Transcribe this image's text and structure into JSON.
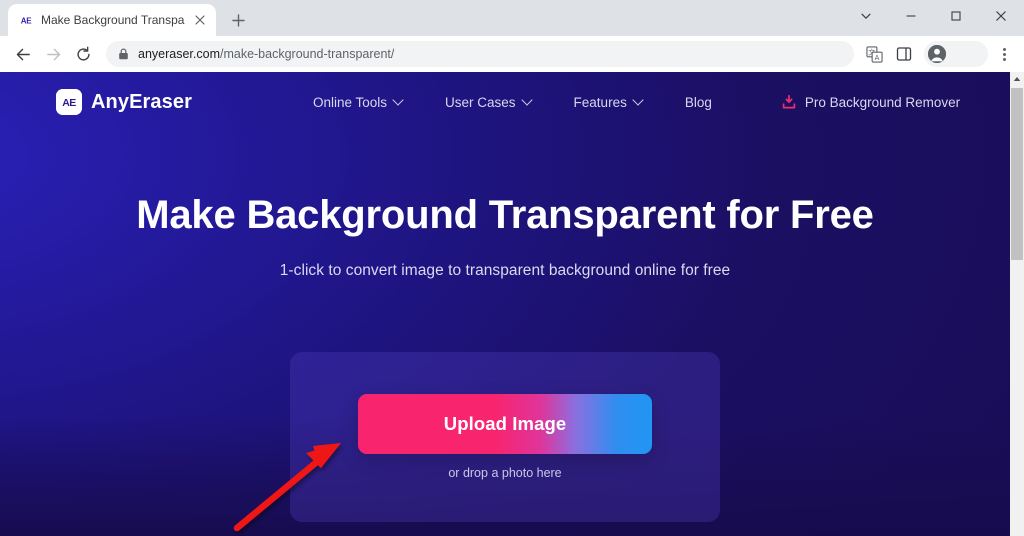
{
  "browser": {
    "tab": {
      "favicon_text": "AE",
      "favicon_icon": "anyeraser-favicon-icon",
      "title": "Make Background Transparent",
      "close_icon": "close-icon"
    },
    "new_tab_icon": "plus-icon",
    "window_controls": {
      "tab_search_icon": "chevron-down-icon",
      "minimize_icon": "minimize-icon",
      "maximize_icon": "maximize-icon",
      "close_icon": "close-icon"
    },
    "toolbar": {
      "back_icon": "arrow-left-icon",
      "forward_icon": "arrow-right-icon",
      "reload_icon": "reload-icon",
      "lock_icon": "lock-icon",
      "url_domain": "anyeraser.com",
      "url_path": "/make-background-transparent/",
      "url_full": "anyeraser.com/make-background-transparent/",
      "translate_icon": "translate-icon",
      "side_panel_icon": "side-panel-icon",
      "profile_icon": "profile-avatar-icon",
      "menu_icon": "kebab-menu-icon"
    }
  },
  "site": {
    "brand": {
      "mark": "AE",
      "name": "AnyEraser"
    },
    "nav": [
      {
        "label": "Online Tools",
        "has_caret": true
      },
      {
        "label": "User Cases",
        "has_caret": true
      },
      {
        "label": "Features",
        "has_caret": true
      },
      {
        "label": "Blog",
        "has_caret": false
      }
    ],
    "nav_pro": {
      "label": "Pro Background Remover",
      "icon": "download-install-icon"
    }
  },
  "hero": {
    "heading": "Make Background Transparent for Free",
    "subheading": "1-click to convert image to transparent background online for free",
    "upload_button_label": "Upload Image",
    "drop_hint": "or drop a photo here"
  },
  "annotation": {
    "arrow_icon": "red-arrow-pointer",
    "color": "#ef1414"
  },
  "colors": {
    "accent_pink": "#f8246d",
    "accent_blue": "#2196f3",
    "page_bg_light": "#2a21ba",
    "page_bg_dark": "#1b0f63",
    "dropzone_bg": "#2e2482",
    "brand_white": "#ffffff"
  },
  "scrollbar": {
    "up_arrow_icon": "scroll-up-arrow-icon"
  }
}
